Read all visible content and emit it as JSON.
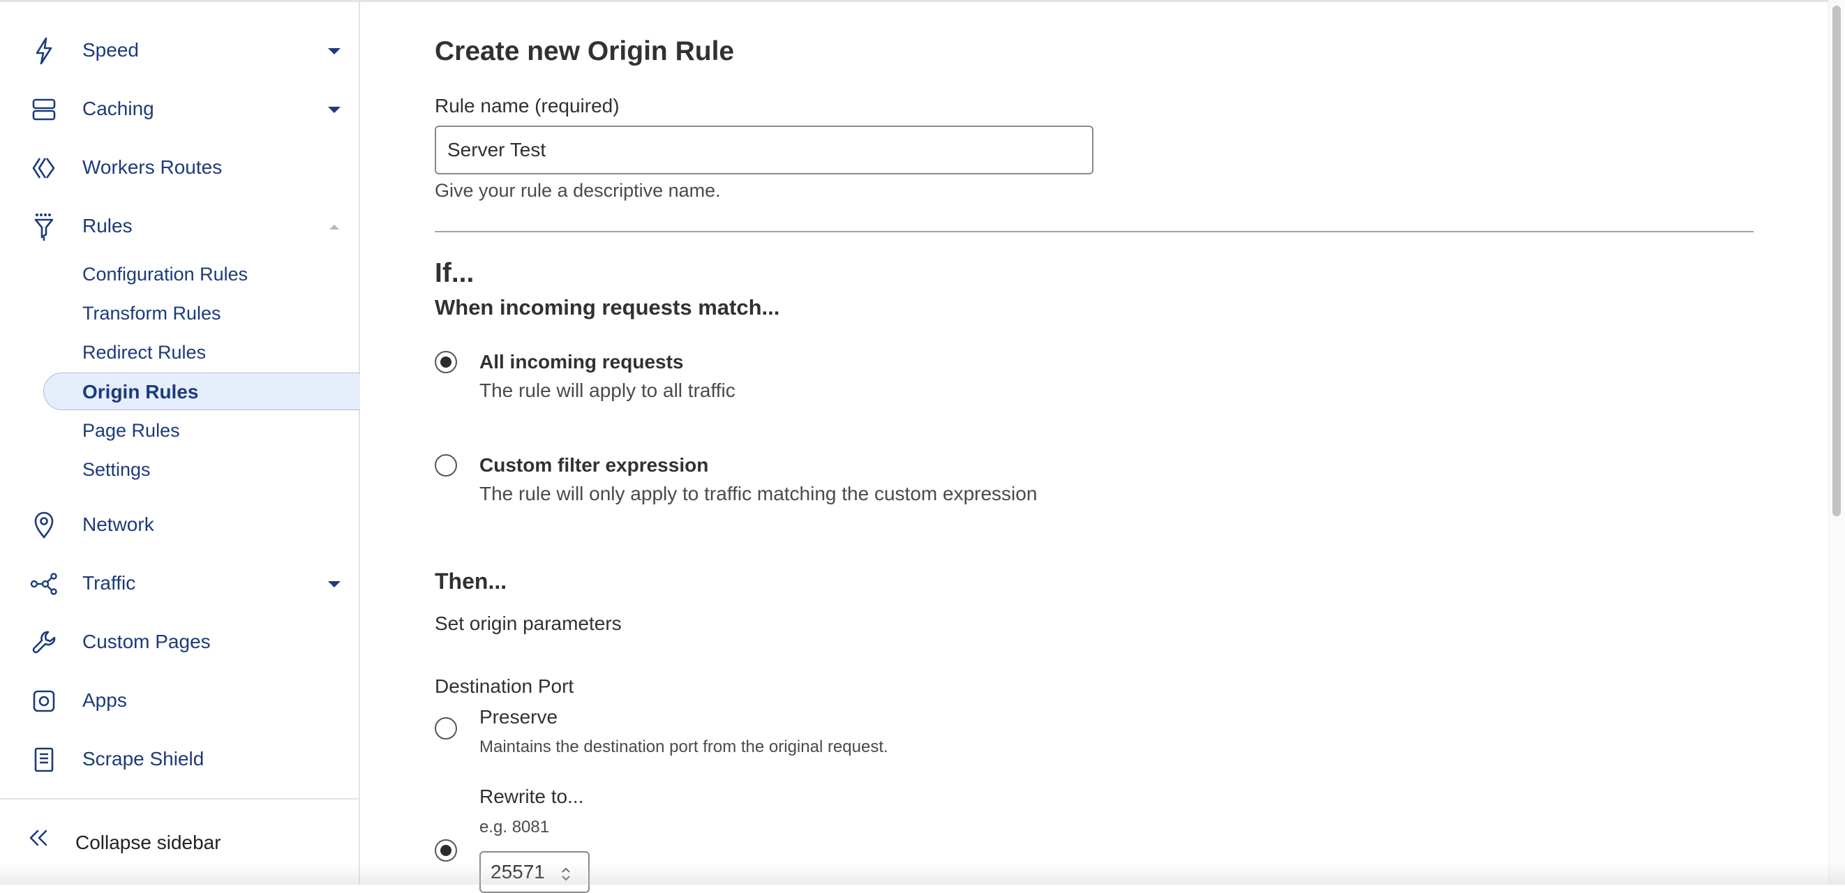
{
  "sidebar": {
    "items": [
      {
        "label": "Speed",
        "icon": "lightning-bolt-icon",
        "has_dropdown": true
      },
      {
        "label": "Caching",
        "icon": "storage-stack-icon",
        "has_dropdown": true
      },
      {
        "label": "Workers Routes",
        "icon": "workers-diamond-icon",
        "has_dropdown": false
      },
      {
        "label": "Rules",
        "icon": "funnel-rules-icon",
        "expanded": true
      },
      {
        "label": "Network",
        "icon": "location-pin-icon",
        "has_dropdown": false
      },
      {
        "label": "Traffic",
        "icon": "traffic-nodes-icon",
        "has_dropdown": true
      },
      {
        "label": "Custom Pages",
        "icon": "wrench-icon",
        "has_dropdown": false
      },
      {
        "label": "Apps",
        "icon": "apps-square-icon",
        "has_dropdown": false
      },
      {
        "label": "Scrape Shield",
        "icon": "document-icon",
        "has_dropdown": false
      }
    ],
    "rules_subitems": [
      "Configuration Rules",
      "Transform Rules",
      "Redirect Rules",
      "Origin Rules",
      "Page Rules",
      "Settings"
    ],
    "active_subitem": "Origin Rules",
    "collapse_label": "Collapse sidebar"
  },
  "main": {
    "title": "Create new Origin Rule",
    "rule_name": {
      "label": "Rule name (required)",
      "value": "Server Test",
      "help": "Give your rule a descriptive name."
    },
    "if_heading": "If...",
    "match_heading": "When incoming requests match...",
    "match_options": [
      {
        "title": "All incoming requests",
        "description": "The rule will apply to all traffic",
        "selected": true
      },
      {
        "title": "Custom filter expression",
        "description": "The rule will only apply to traffic matching the custom expression",
        "selected": false
      }
    ],
    "then_heading": "Then...",
    "set_origin_text": "Set origin parameters",
    "destination_port": {
      "label": "Destination Port",
      "preserve_title": "Preserve",
      "preserve_description": "Maintains the destination port from the original request.",
      "preserve_selected": false,
      "rewrite_title": "Rewrite to...",
      "rewrite_placeholder": "e.g. 8081",
      "rewrite_selected": true,
      "rewrite_value": "25571"
    }
  },
  "colors": {
    "nav_text": "#1c3b7a",
    "active_bg": "#e6eefb",
    "text": "#313131"
  }
}
